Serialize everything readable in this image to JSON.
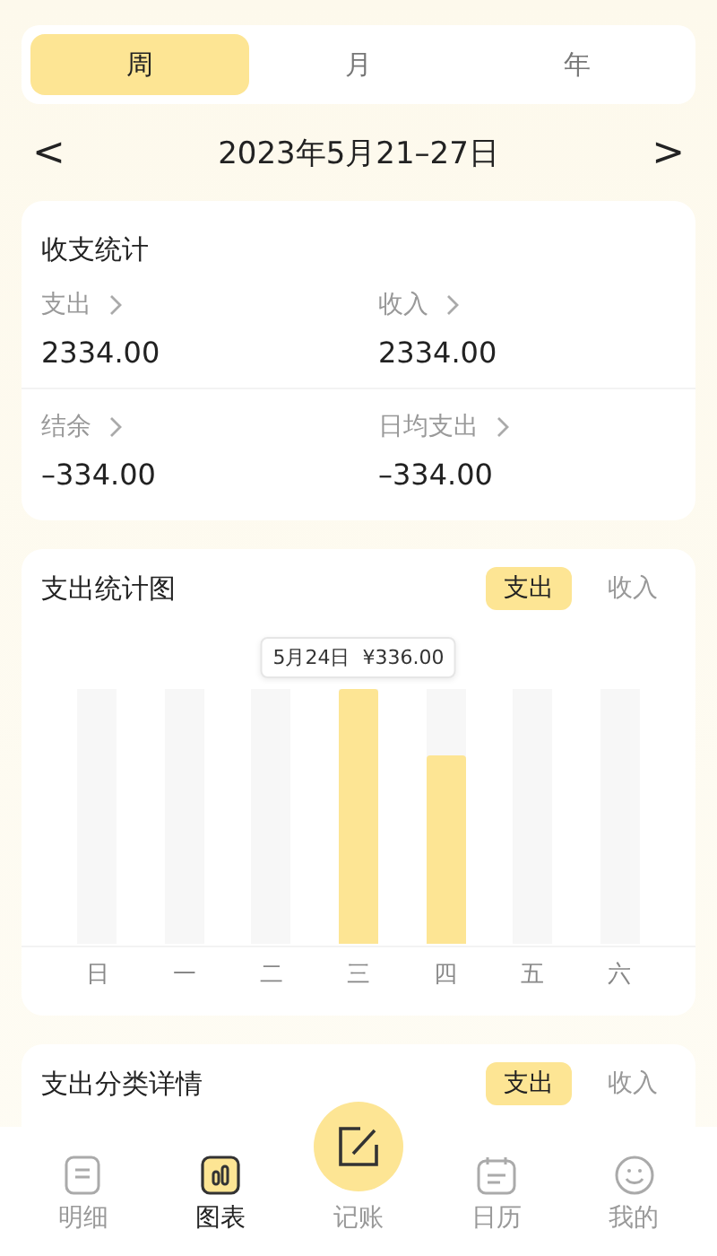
{
  "period_tabs": [
    {
      "label": "周",
      "selected": true
    },
    {
      "label": "月",
      "selected": false
    },
    {
      "label": "年",
      "selected": false
    }
  ],
  "date_nav": {
    "prev": "<",
    "title": "2023年5月21–27日",
    "next": ">"
  },
  "summary": {
    "title": "收支统计",
    "items": [
      {
        "label": "支出",
        "value": "2334.00"
      },
      {
        "label": "收入",
        "value": "2334.00"
      },
      {
        "label": "结余",
        "value": "–334.00"
      },
      {
        "label": "日均支出",
        "value": "–334.00"
      }
    ]
  },
  "chart_card": {
    "title": "支出统计图",
    "toggle": [
      {
        "label": "支出",
        "selected": true
      },
      {
        "label": "收入",
        "selected": false
      }
    ],
    "days": [
      {
        "label": "日"
      },
      {
        "label": "一"
      },
      {
        "label": "二"
      },
      {
        "label": "三",
        "level": 1,
        "tooltip": "5月24日  ¥336.00"
      },
      {
        "label": "四",
        "level": 0.74
      },
      {
        "label": "五"
      },
      {
        "label": "六"
      }
    ]
  },
  "category_card": {
    "title": "支出分类详情",
    "toggle": [
      {
        "label": "支出",
        "selected": true
      },
      {
        "label": "收入",
        "selected": false
      }
    ]
  },
  "tab_bar": [
    {
      "kind": "list",
      "label": "明细",
      "selected": false
    },
    {
      "kind": "chart",
      "label": "图表",
      "selected": true
    },
    {
      "kind": "add",
      "label": "记账",
      "selected": false
    },
    {
      "kind": "calendar",
      "label": "日历",
      "selected": false
    },
    {
      "kind": "profile",
      "label": "我的",
      "selected": false
    }
  ]
}
